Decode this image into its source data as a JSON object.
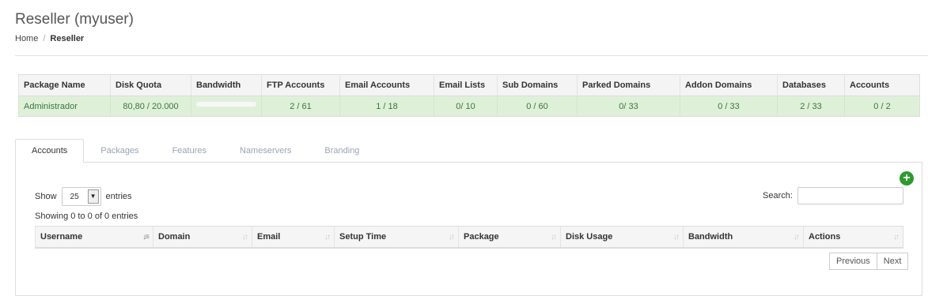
{
  "header": {
    "title": "Reseller (myuser)",
    "breadcrumb": {
      "home": "Home",
      "separator": "/",
      "current": "Reseller"
    }
  },
  "package_table": {
    "columns": [
      "Package Name",
      "Disk Quota",
      "Bandwidth",
      "FTP Accounts",
      "Email Accounts",
      "Email Lists",
      "Sub Domains",
      "Parked Domains",
      "Addon Domains",
      "Databases",
      "Accounts"
    ],
    "row": {
      "package_name": "Administrador",
      "disk_quota": "80,80 / 20.000",
      "ftp_accounts": "2 / 61",
      "email_accounts": "1 / 18",
      "email_lists": "0/ 10",
      "sub_domains": "0 / 60",
      "parked_domains": "0/ 33",
      "addon_domains": "0 / 33",
      "databases": "2 / 33",
      "accounts": "0 / 2"
    },
    "row_color": "#dff0d8"
  },
  "tabs": [
    "Accounts",
    "Packages",
    "Features",
    "Nameservers",
    "Branding"
  ],
  "accounts": {
    "add_icon": "plus-circle-icon",
    "show_label": "Show",
    "page_size": "25",
    "entries_label": "entries",
    "search_label": "Search:",
    "search_value": "",
    "info": "Showing 0 to 0 of 0 entries",
    "columns": [
      "Username",
      "Domain",
      "Email",
      "Setup Time",
      "Package",
      "Disk Usage",
      "Bandwidth",
      "Actions"
    ],
    "previous": "Previous",
    "next": "Next"
  }
}
